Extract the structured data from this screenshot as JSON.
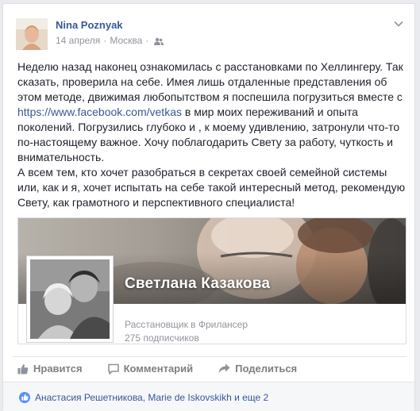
{
  "post": {
    "author": "Nina Poznyak",
    "date": "14 апреля",
    "separator": "·",
    "location": "Москва",
    "privacy_icon": "friends-icon",
    "menu_icon": "chevron-down-icon",
    "text_before_link": "Неделю назад наконец ознакомилась с расстановками по Хеллингеру. Так сказать, проверила на себе. Имея лишь отдаленные представления об этом методе, движимая любопытством я поспешила погрузиться вместе с ",
    "link": "https://www.facebook.com/vetkas",
    "text_after_link": " в мир моих переживаний и опыта поколений. Погрузились глубоко и , к моему удивлению, затронули что-то по-настоящему важное. Хочу поблагодарить Свету за работу, чуткость и внимательность.",
    "paragraph_2": "А всем тем, кто хочет разобраться в секретах своей семейной системы или, как и я, хочет испытать на себе такой интересный метод, рекомендую Свету, как грамотного и перспективного специалиста!"
  },
  "attachment": {
    "page_name": "Светлана Казакова",
    "category": "Расстановщик в Фрилансер",
    "subscribers": "275 подписчиков"
  },
  "actions": {
    "like": "Нравится",
    "comment": "Комментарий",
    "share": "Поделиться"
  },
  "likes": {
    "text": "Анастасия Решетникова, Marie de Iskovskikh и еще 2"
  },
  "colors": {
    "link": "#365899",
    "meta": "#90949c",
    "like_badge": "#5890ff"
  }
}
